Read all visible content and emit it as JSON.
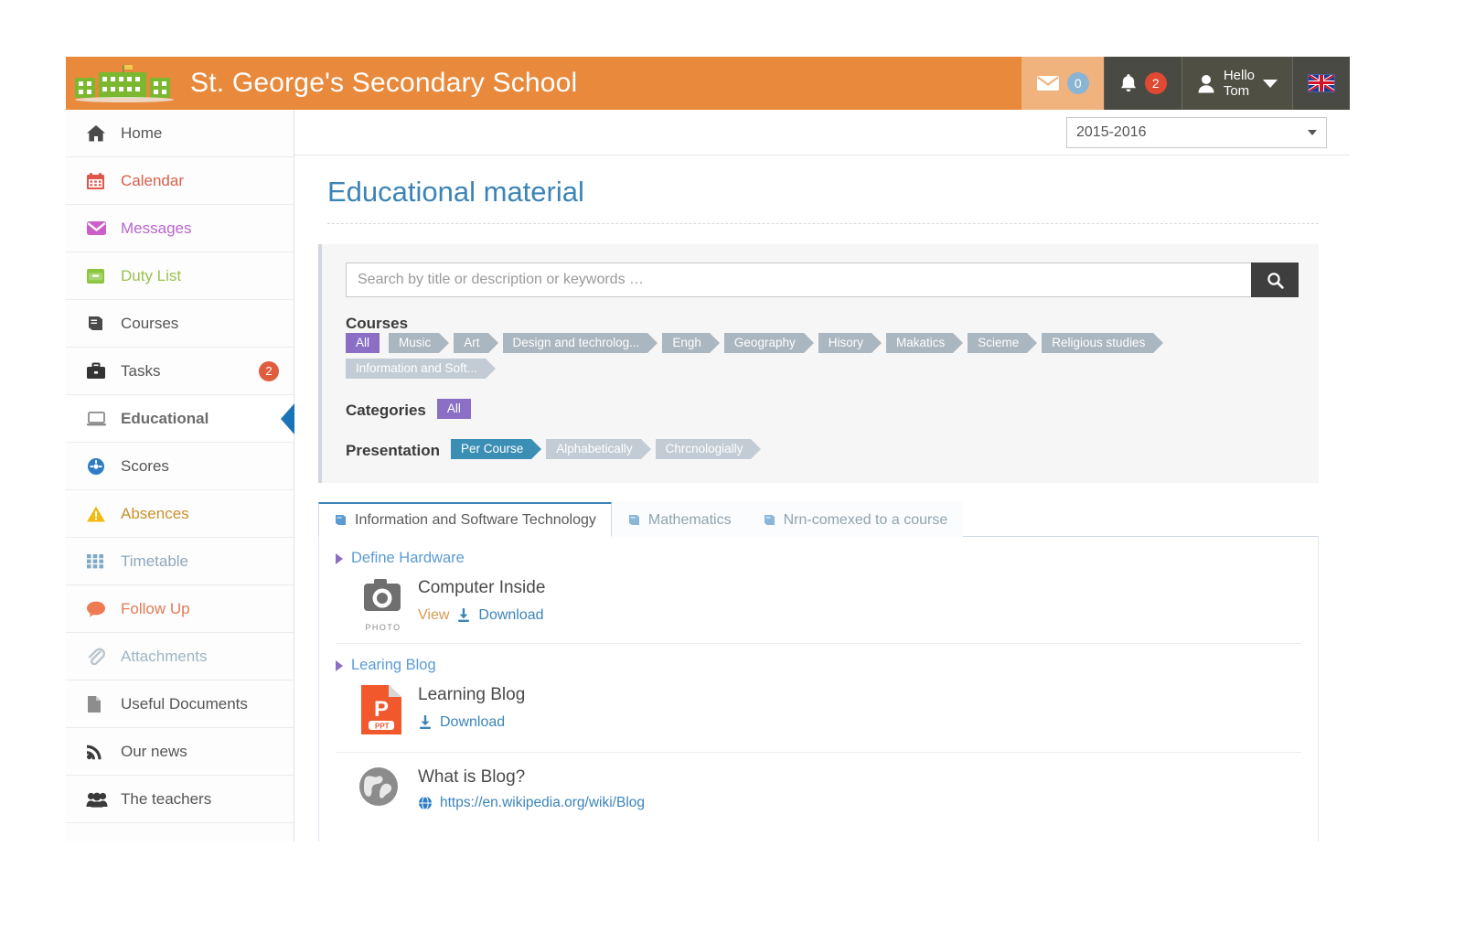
{
  "header": {
    "school_name": "St. George's Secondary School",
    "logo_icon": "school-building-icon",
    "mail_icon": "envelope-icon",
    "mail_count": "0",
    "bell_icon": "bell-icon",
    "bell_count": "2",
    "user_icon": "person-icon",
    "greeting_line1": "Hello",
    "greeting_line2": "Tom",
    "caret_icon": "chevron-down-icon",
    "flag_icon": "uk-flag-icon"
  },
  "sidebar": {
    "items": [
      {
        "label": "Home",
        "icon": "home-icon",
        "color": "#4a4a4a",
        "active": false,
        "badge": ""
      },
      {
        "label": "Calendar",
        "icon": "calendar-icon",
        "color": "#e0564b",
        "active": false,
        "badge": ""
      },
      {
        "label": "Messages",
        "icon": "envelope-icon",
        "color": "#cc5ecc",
        "active": false,
        "badge": ""
      },
      {
        "label": "Duty List",
        "icon": "clipboard-icon",
        "color": "#8cc63f",
        "active": false,
        "badge": ""
      },
      {
        "label": "Courses",
        "icon": "book-icon",
        "color": "#4a4a4a",
        "active": false,
        "badge": ""
      },
      {
        "label": "Tasks",
        "icon": "briefcase-icon",
        "color": "#333333",
        "active": false,
        "badge": "2"
      },
      {
        "label": "Educational",
        "icon": "laptop-icon",
        "color": "#8a8a8a",
        "active": true,
        "badge": ""
      },
      {
        "label": "Scores",
        "icon": "gauge-icon",
        "color": "#2e7dc4",
        "active": false,
        "badge": ""
      },
      {
        "label": "Absences",
        "icon": "warning-triangle-icon",
        "color": "#f2bb13",
        "active": false,
        "badge": ""
      },
      {
        "label": "Timetable",
        "icon": "grid-icon",
        "color": "#7fa8c9",
        "active": false,
        "badge": ""
      },
      {
        "label": "Follow Up",
        "icon": "chat-bubble-icon",
        "color": "#ef7b52",
        "active": false,
        "badge": ""
      },
      {
        "label": "Attachments",
        "icon": "paperclip-icon",
        "color": "#b9c4cc",
        "active": false,
        "badge": ""
      },
      {
        "label": "Useful Documents",
        "icon": "document-icon",
        "color": "#8d8d8d",
        "active": false,
        "badge": ""
      },
      {
        "label": "Our news",
        "icon": "rss-icon",
        "color": "#3a3a3a",
        "active": false,
        "badge": ""
      },
      {
        "label": "The teachers",
        "icon": "people-icon",
        "color": "#3a3a3a",
        "active": false,
        "badge": ""
      }
    ]
  },
  "main": {
    "year_selector": {
      "value": "2015-2016",
      "caret_icon": "chevron-down-icon"
    },
    "page_title": "Educational material",
    "search": {
      "placeholder": "Search by title or description or keywords …",
      "value": "",
      "button_icon": "search-icon"
    },
    "filters": {
      "courses_label": "Courses",
      "courses": [
        {
          "label": "All",
          "style": "purple-flat"
        },
        {
          "label": "Music",
          "style": "chevron"
        },
        {
          "label": "Art",
          "style": "chevron"
        },
        {
          "label": "Design and techrolog...",
          "style": "chevron"
        },
        {
          "label": "Engh",
          "style": "chevron"
        },
        {
          "label": "Geography",
          "style": "chevron"
        },
        {
          "label": "Hisory",
          "style": "chevron"
        },
        {
          "label": "Makatics",
          "style": "chevron"
        },
        {
          "label": "Scieme",
          "style": "chevron"
        },
        {
          "label": "Religious studies",
          "style": "chevron"
        },
        {
          "label": "Information and Soft...",
          "style": "chevron-light"
        }
      ],
      "categories_label": "Categories",
      "categories": [
        {
          "label": "All",
          "style": "purple-flat"
        }
      ],
      "presentation_label": "Presentation",
      "presentation": [
        {
          "label": "Per Course",
          "style": "blue-chevron"
        },
        {
          "label": "Alphabetically",
          "style": "chevron-light"
        },
        {
          "label": "Chrcnologially",
          "style": "chevron-light"
        }
      ]
    },
    "tabs": [
      {
        "label": "Information and Software Technology",
        "icon": "book-icon",
        "active": true
      },
      {
        "label": "Mathematics",
        "icon": "book-icon",
        "active": false
      },
      {
        "label": "Nrn-comexed to a course",
        "icon": "book-icon",
        "active": false
      }
    ],
    "groups": [
      {
        "title": "Define Hardware",
        "chevron_icon": "chevron-right-icon",
        "materials": [
          {
            "title": "Computer Inside",
            "icon": "photo-camera-icon",
            "icon_caption": "PHOTO",
            "view_label": "View",
            "download_label": "Download",
            "download_icon": "download-icon",
            "url": ""
          }
        ]
      },
      {
        "title": "Learing Blog",
        "chevron_icon": "chevron-right-icon",
        "materials": [
          {
            "title": "Learning Blog",
            "icon": "ppt-file-icon",
            "icon_caption": "PPT",
            "view_label": "",
            "download_label": "Download",
            "download_icon": "download-icon",
            "url": ""
          },
          {
            "title": "What is Blog?",
            "icon": "globe-icon",
            "icon_caption": "",
            "view_label": "",
            "download_label": "",
            "download_icon": "",
            "url": "https://en.wikipedia.org/wiki/Blog",
            "url_icon": "globe-small-icon"
          }
        ]
      }
    ]
  },
  "colors": {
    "brand_orange": "#e8893c",
    "accent_blue": "#3b84b8",
    "active_marker": "#1a73b8",
    "pill_gray": "#aab6c0",
    "pill_purple": "#8a6fc4",
    "pill_blue": "#3b8fb5",
    "badge_red": "#e04a32"
  }
}
